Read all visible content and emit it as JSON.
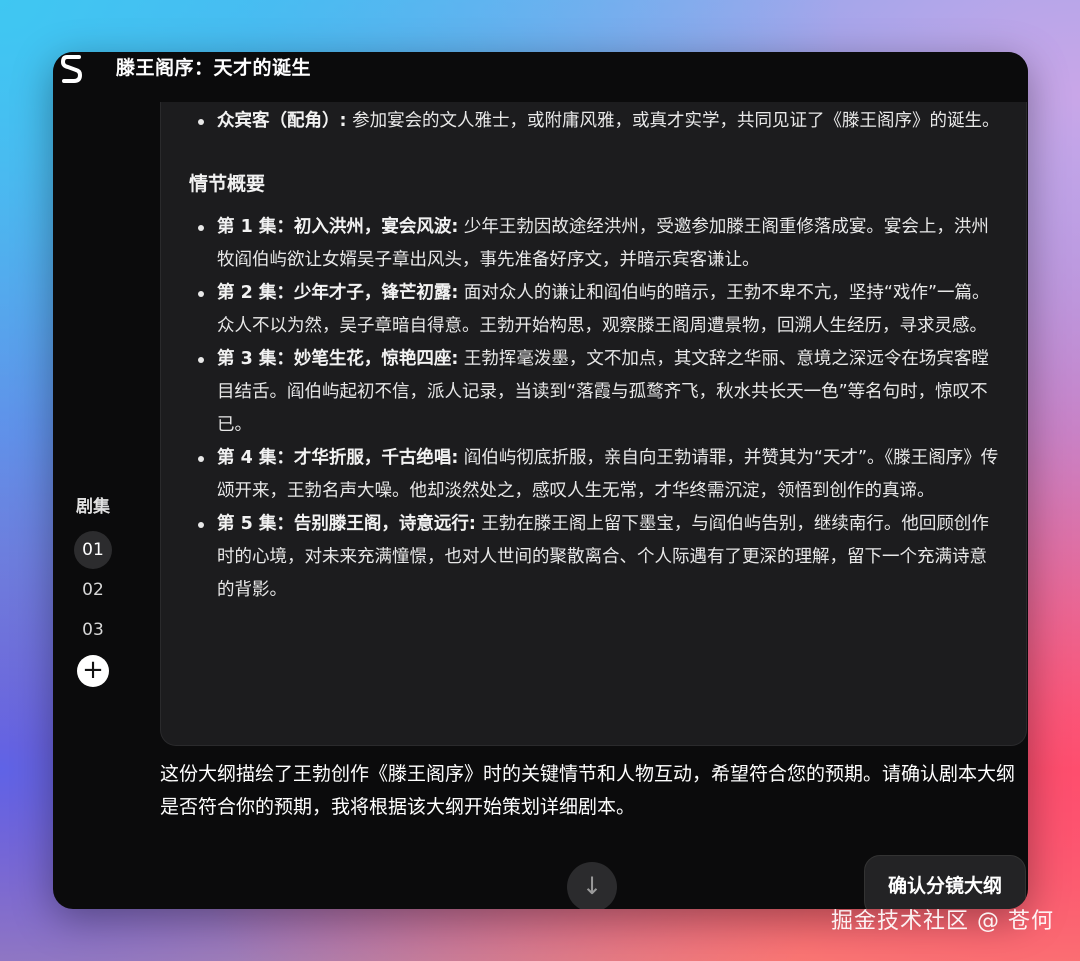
{
  "window": {
    "title": "滕王阁序：天才的诞生"
  },
  "characters": {
    "guests_label": "众宾客（配角）:",
    "guests_text": " 参加宴会的文人雅士，或附庸风雅，或真才实学，共同见证了《滕王阁序》的诞生。"
  },
  "plot": {
    "heading": "情节概要",
    "episodes": [
      {
        "label": "第 1 集：初入洪州，宴会风波:",
        "text": " 少年王勃因故途经洪州，受邀参加滕王阁重修落成宴。宴会上，洪州牧阎伯屿欲让女婿吴子章出风头，事先准备好序文，并暗示宾客谦让。"
      },
      {
        "label": "第 2 集：少年才子，锋芒初露:",
        "text": " 面对众人的谦让和阎伯屿的暗示，王勃不卑不亢，坚持“戏作”一篇。众人不以为然，吴子章暗自得意。王勃开始构思，观察滕王阁周遭景物，回溯人生经历，寻求灵感。"
      },
      {
        "label": "第 3 集：妙笔生花，惊艳四座:",
        "text": " 王勃挥毫泼墨，文不加点，其文辞之华丽、意境之深远令在场宾客瞠目结舌。阎伯屿起初不信，派人记录，当读到“落霞与孤鹜齐飞，秋水共长天一色”等名句时，惊叹不已。"
      },
      {
        "label": "第 4 集：才华折服，千古绝唱:",
        "text": " 阎伯屿彻底折服，亲自向王勃请罪，并赞其为“天才”。《滕王阁序》传颂开来，王勃名声大噪。他却淡然处之，感叹人生无常，才华终需沉淀，领悟到创作的真谛。"
      },
      {
        "label": "第 5 集：告别滕王阁，诗意远行:",
        "text": " 王勃在滕王阁上留下墨宝，与阎伯屿告别，继续南行。他回顾创作时的心境，对未来充满憧憬，也对人世间的聚散离合、个人际遇有了更深的理解，留下一个充满诗意的背影。"
      }
    ]
  },
  "sidebar": {
    "title": "剧集",
    "episodes": [
      "01",
      "02",
      "03"
    ],
    "add_icon": "plus-icon"
  },
  "message": {
    "summary": "这份大纲描绘了王勃创作《滕王阁序》时的关键情节和人物互动，希望符合您的预期。请确认剧本大纲是否符合你的预期，我将根据该大纲开始策划详细剧本。"
  },
  "actions": {
    "scroll_icon": "arrow-down-icon",
    "confirm_label": "确认分镜大纲"
  },
  "watermark": "掘金技术社区 @ 苍何"
}
